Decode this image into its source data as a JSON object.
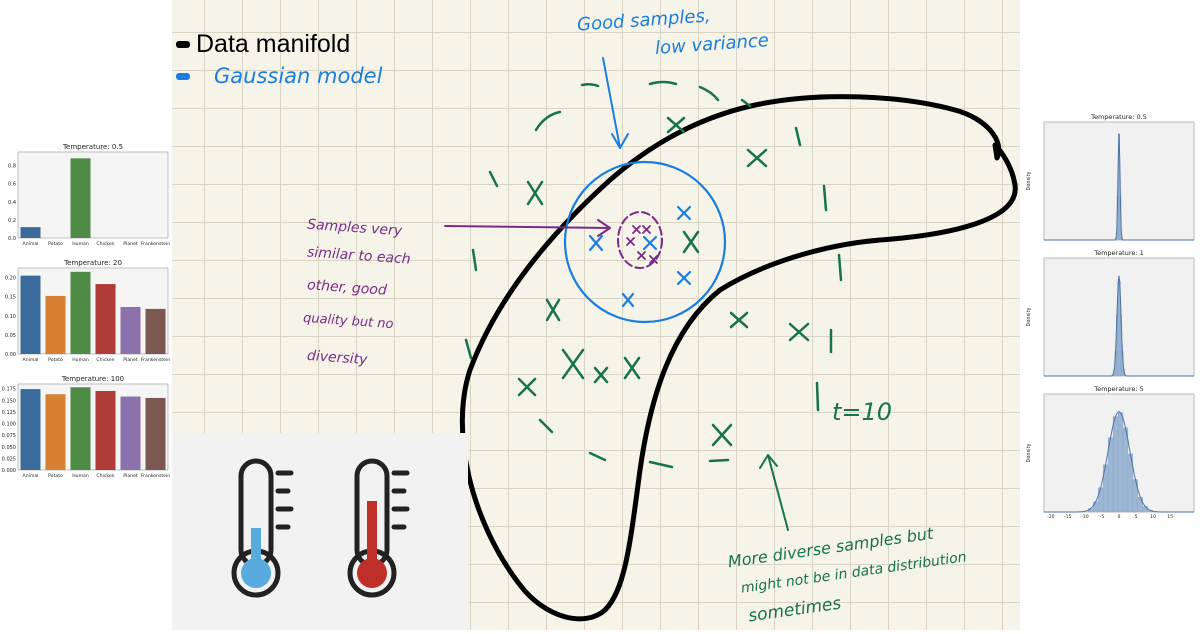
{
  "legend": {
    "items": [
      {
        "label": "Data manifold",
        "color": "#000000"
      },
      {
        "label": "Gaussian model",
        "color": "#1a7ee0"
      }
    ]
  },
  "annotations": {
    "top": [
      "Good samples,",
      "low variance"
    ],
    "left": [
      "Samples very",
      "similar to each",
      "other, good",
      "quality but no",
      "diversity"
    ],
    "bottom": [
      "More diverse samples but",
      "might not be in data distribution",
      "sometimes"
    ],
    "temperature_label": "t=10"
  },
  "colors": {
    "black": "#000000",
    "blue": "#1a7ee0",
    "purple": "#7b2a8a",
    "green": "#17734a"
  },
  "icons": [
    "thermometer-cold-icon",
    "thermometer-hot-icon"
  ],
  "chart_data": [
    {
      "type": "bar",
      "title": "Temperature: 0.5",
      "categories": [
        "Animal",
        "Potato",
        "Human",
        "Chicken",
        "Planet",
        "Frankenstein"
      ],
      "values": [
        0.12,
        0,
        0.88,
        0,
        0,
        0
      ],
      "yticks": [
        "0.0",
        "0.2",
        "0.4",
        "0.6",
        "0.8"
      ],
      "ylim": [
        0,
        0.95
      ]
    },
    {
      "type": "bar",
      "title": "Temperature: 20",
      "categories": [
        "Animal",
        "Potato",
        "Human",
        "Chicken",
        "Planet",
        "Frankenstein"
      ],
      "values": [
        0.205,
        0.152,
        0.215,
        0.183,
        0.123,
        0.118
      ],
      "yticks": [
        "0.00",
        "0.05",
        "0.10",
        "0.15",
        "0.20"
      ],
      "ylim": [
        0,
        0.225
      ]
    },
    {
      "type": "bar",
      "title": "Temperature: 100",
      "categories": [
        "Animal",
        "Potato",
        "Human",
        "Chicken",
        "Planet",
        "Frankenstein"
      ],
      "values": [
        0.174,
        0.163,
        0.178,
        0.17,
        0.158,
        0.155
      ],
      "yticks": [
        "0.000",
        "0.025",
        "0.050",
        "0.075",
        "0.100",
        "0.125",
        "0.150",
        "0.175"
      ],
      "ylim": [
        0,
        0.185
      ]
    },
    {
      "type": "area",
      "title": "Temperature: 0.5",
      "ylabel": "Density",
      "sigma": 0.3,
      "peak": 0.9
    },
    {
      "type": "area",
      "title": "Temperature: 1",
      "ylabel": "Density",
      "sigma": 0.6,
      "peak": 0.85
    },
    {
      "type": "area",
      "title": "Temperature: 5",
      "ylabel": "Density",
      "sigma": 3.2,
      "peak": 0.85,
      "xticks": [
        "-20",
        "-15",
        "-10",
        "-5",
        "0",
        "5",
        "10",
        "15"
      ]
    }
  ]
}
